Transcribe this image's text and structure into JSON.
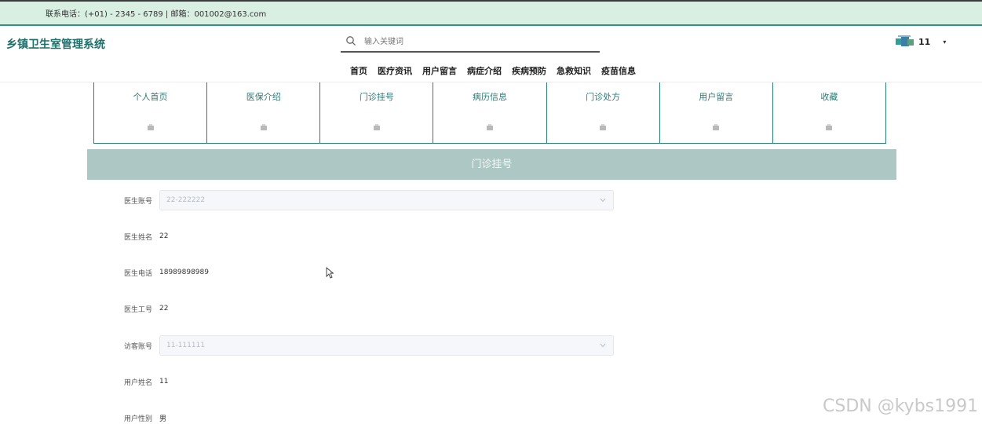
{
  "topbar": {
    "contact": "联系电话：(+01) - 2345 - 6789 | 邮箱：001002@163.com"
  },
  "header": {
    "brand": "乡镇卫生室管理系统",
    "search": {
      "placeholder": "输入关键词",
      "icon": "search-icon"
    },
    "user": {
      "name": "11",
      "avatar": "avatar-icon",
      "caret": "▾"
    }
  },
  "nav": [
    "首页",
    "医疗资讯",
    "用户留言",
    "病症介绍",
    "疾病预防",
    "急救知识",
    "疫苗信息"
  ],
  "tiles": [
    "个人首页",
    "医保介绍",
    "门诊挂号",
    "病历信息",
    "门诊处方",
    "用户留言",
    "收藏"
  ],
  "banner": {
    "title": "门诊挂号"
  },
  "form": {
    "doctor_account": {
      "label": "医生账号",
      "value": "22-222222"
    },
    "doctor_name": {
      "label": "医生姓名",
      "value": "22"
    },
    "doctor_phone": {
      "label": "医生电话",
      "value": "18989898989"
    },
    "doctor_id": {
      "label": "医生工号",
      "value": "22"
    },
    "visitor_account": {
      "label": "访客账号",
      "value": "11-111111"
    },
    "user_name": {
      "label": "用户姓名",
      "value": "11"
    },
    "user_gender": {
      "label": "用户性别",
      "value": "男"
    }
  },
  "watermark": "CSDN @kybs1991",
  "colors": {
    "topbar_bg": "#d8efe2",
    "accent": "#2b7b76",
    "banner_bg": "#adc8c4",
    "brand": "#1d6f6b"
  }
}
